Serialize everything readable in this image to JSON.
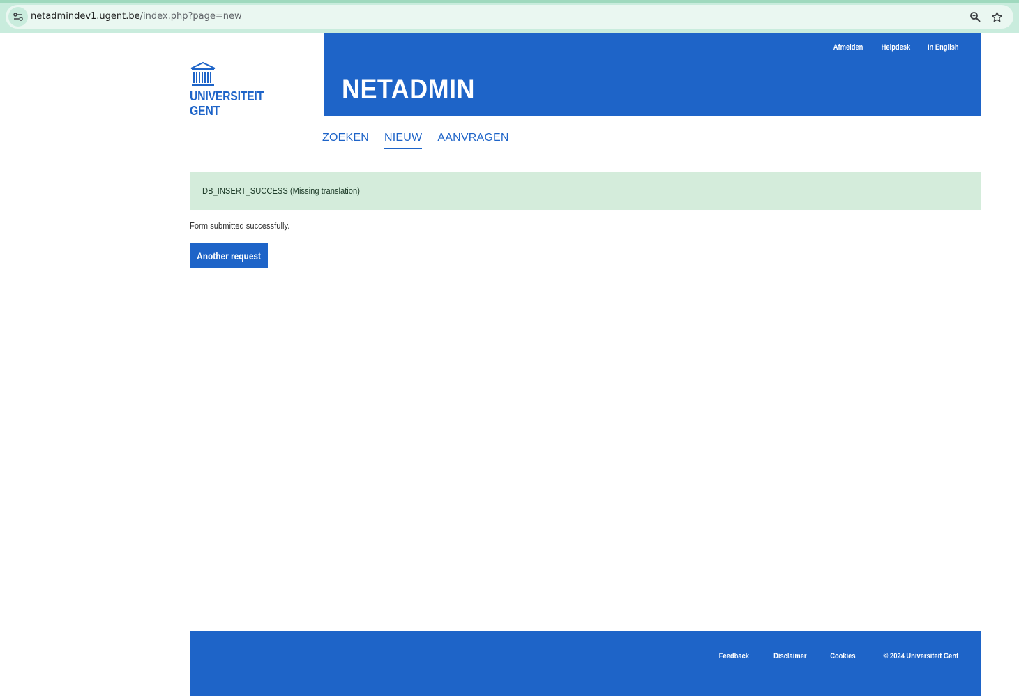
{
  "browser": {
    "url_host": "netadmindev1.ugent.be",
    "url_path": "/index.php?page=new",
    "icons": [
      "site-info-icon",
      "zoom-icon",
      "bookmark-star-icon"
    ]
  },
  "logo": {
    "line1": "UNIVERSITEIT",
    "line2": "GENT"
  },
  "header": {
    "title": "NETADMIN",
    "links": [
      "Afmelden",
      "Helpdesk",
      "In English"
    ]
  },
  "nav": {
    "items": [
      {
        "label": "ZOEKEN",
        "active": false
      },
      {
        "label": "NIEUW",
        "active": true
      },
      {
        "label": "AANVRAGEN",
        "active": false
      }
    ]
  },
  "alert": {
    "text": "DB_INSERT_SUCCESS (Missing translation)"
  },
  "main": {
    "message": "Form submitted successfully.",
    "button_label": "Another request"
  },
  "footer": {
    "links": [
      "Feedback",
      "Disclaimer",
      "Cookies"
    ],
    "copyright": "© 2024 Universiteit Gent"
  },
  "colors": {
    "brand_blue": "#1e64c8",
    "alert_green": "#d4ecdb",
    "browser_bar": "#c9ecdd"
  }
}
